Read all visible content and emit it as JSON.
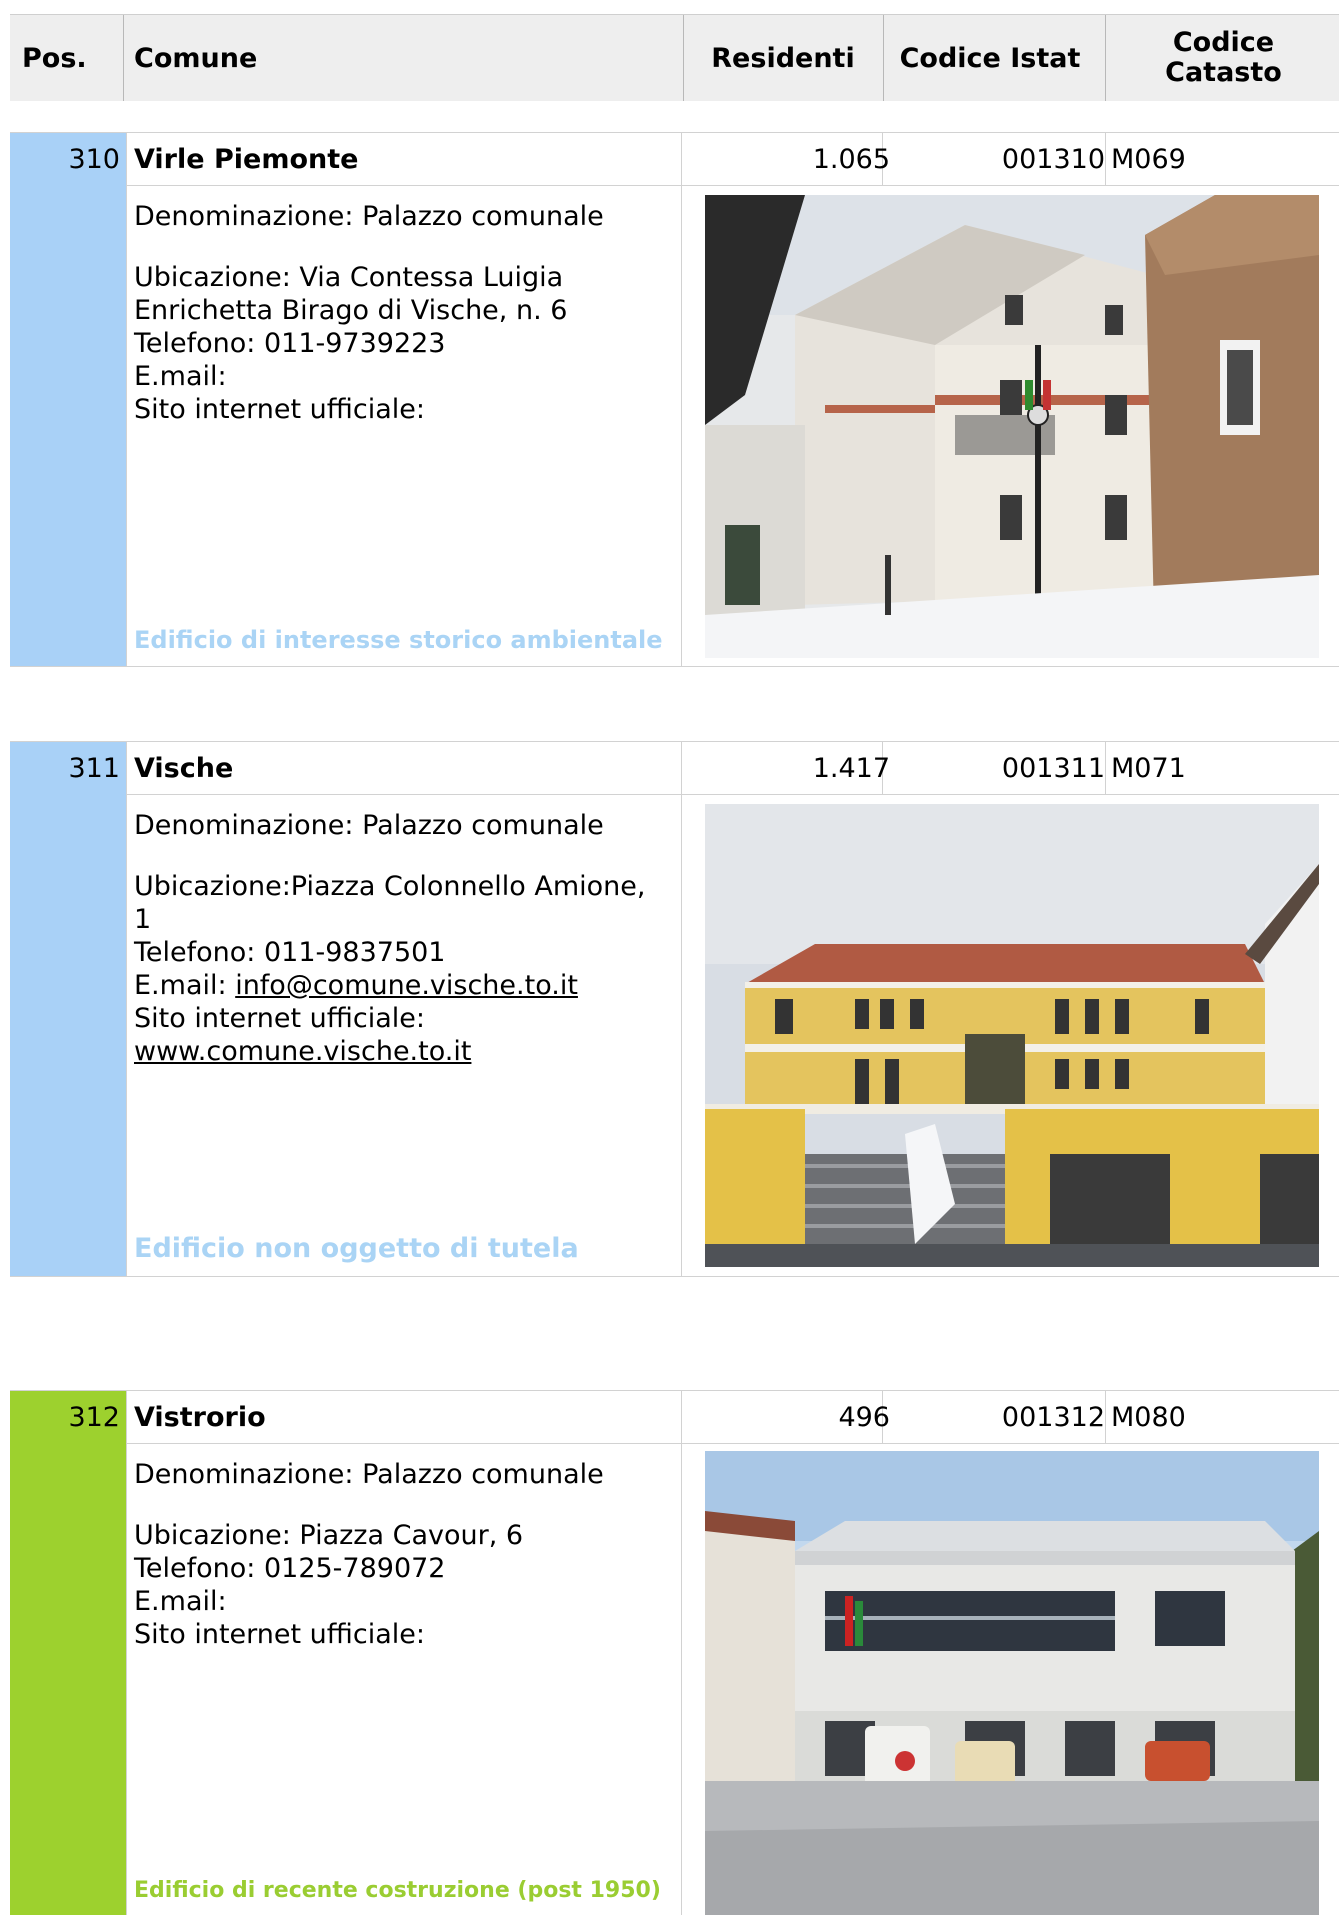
{
  "header": {
    "pos": "Pos.",
    "comune": "Comune",
    "residenti": "Residenti",
    "istat": "Codice Istat",
    "catasto_line1": "Codice",
    "catasto_line2": "Catasto"
  },
  "entries": [
    {
      "pos": "310",
      "comune": "Virle Piemonte",
      "residenti": "1.065",
      "istat": "001310",
      "catasto": "M069",
      "denominazione": "Denominazione: Palazzo comunale",
      "ubicazione": "Ubicazione: Via Contessa Luigia Enrichetta Birago di Vische, n. 6",
      "telefono": "Telefono: 011-9739223",
      "email_label": "E.mail:",
      "email": "",
      "sito_label": "Sito internet ufficiale:",
      "sito": "",
      "status": "Edificio di interesse storico ambientale",
      "status_color": "#aad4f5",
      "bar_color": "#a9d1f7"
    },
    {
      "pos": "311",
      "comune": "Vische",
      "residenti": "1.417",
      "istat": "001311",
      "catasto": "M071",
      "denominazione": "Denominazione: Palazzo comunale",
      "ubicazione": "Ubicazione:Piazza Colonnello Amione, 1",
      "telefono": "Telefono: 011-9837501",
      "email_label": "E.mail:",
      "email": "info@comune.vische.to.it",
      "sito_label": "Sito internet ufficiale:",
      "sito": "www.comune.vische.to.it",
      "status": "Edificio non oggetto di tutela",
      "status_color": "#aad4f5",
      "bar_color": "#a9d1f7"
    },
    {
      "pos": "312",
      "comune": "Vistrorio",
      "residenti": "496",
      "istat": "001312",
      "catasto": "M080",
      "denominazione": "Denominazione: Palazzo comunale",
      "ubicazione": "Ubicazione: Piazza Cavour, 6",
      "telefono": "Telefono: 0125-789072",
      "email_label": "E.mail:",
      "email": "",
      "sito_label": "Sito internet ufficiale:",
      "sito": "",
      "status": "Edificio di recente costruzione (post 1950)",
      "status_color": "#9acd32",
      "bar_color": "#9dd12e"
    }
  ]
}
